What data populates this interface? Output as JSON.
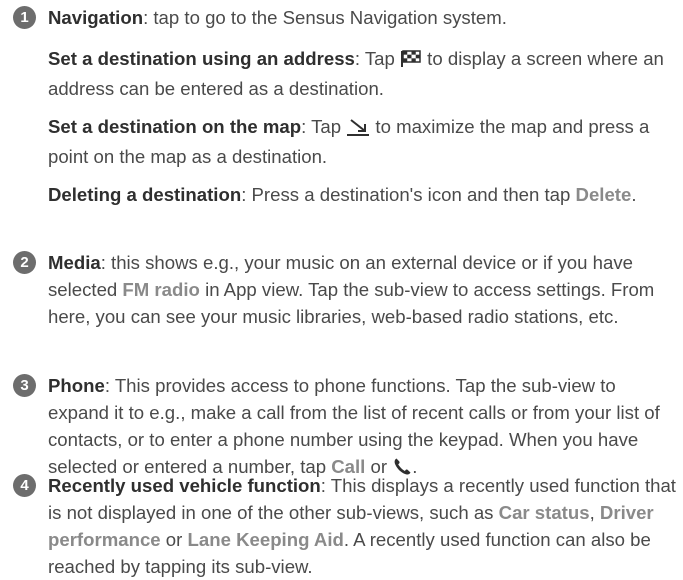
{
  "items": [
    {
      "number": "1",
      "lead": {
        "term": "Navigation",
        "rest": ": tap to go to the Sensus Navigation system."
      },
      "address": {
        "term": "Set a destination using an address",
        "pre": ": Tap ",
        "icon": "checkered-flag-icon",
        "post": " to display a screen where an address can be entered as a destination."
      },
      "map": {
        "term": "Set a destination on the map",
        "pre": ": Tap ",
        "icon": "maximize-arrow-icon",
        "post": " to maximize the map and press a point on the map as a destination."
      },
      "delete": {
        "term": "Deleting a destination",
        "pre": ": Press a destination's icon and then tap ",
        "ui": "Delete",
        "post": "."
      }
    },
    {
      "number": "2",
      "term": "Media",
      "pre": ": this shows e.g., your music on an external device or if you have selected ",
      "ui": "FM radio",
      "post": " in App view. Tap the sub-view to access settings. From here, you can see your music libraries, web-based radio stations, etc."
    },
    {
      "number": "3",
      "term": "Phone",
      "pre": ": This provides access to phone functions. Tap the sub-view to expand it to e.g., make a call from the list of recent calls or from your list of contacts, or to enter a phone number using the keypad. When you have selected or entered a number, tap ",
      "ui": "Call",
      "mid": " or ",
      "icon": "phone-handset-icon",
      "post": "."
    },
    {
      "number": "4",
      "term": "Recently used vehicle function",
      "pre": ": This displays a recently used function that is not displayed in one of the other sub-views, such as ",
      "ui1": "Car status",
      "sep1": ", ",
      "ui2": "Driver performance",
      "sep2": " or ",
      "ui3": "Lane Keeping Aid",
      "post": ". A recently used function can also be reached by tapping its sub-view."
    }
  ]
}
